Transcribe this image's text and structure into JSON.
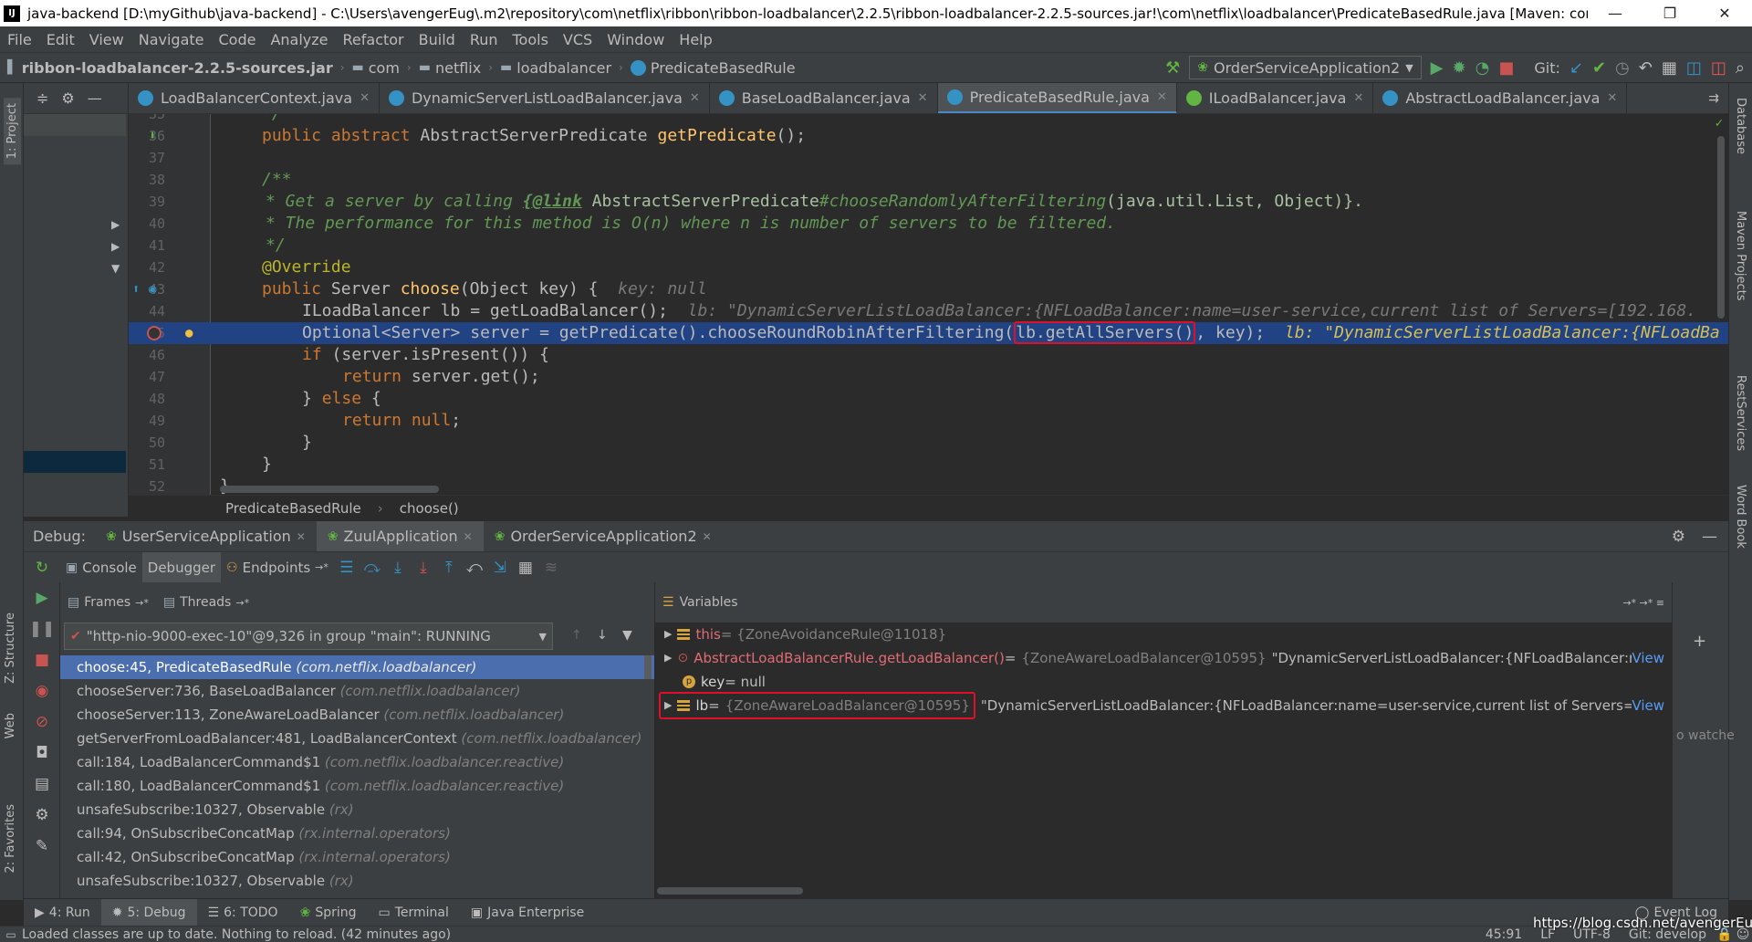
{
  "window": {
    "title": "java-backend [D:\\myGithub\\java-backend] - C:\\Users\\avengerEug\\.m2\\repository\\com\\netflix\\ribbon\\ribbon-loadbalancer\\2.2.5\\ribbon-loadbalancer-2.2.5-sources.jar!\\com\\netflix\\loadbalancer\\PredicateBasedRule.java [Maven: com.ne...",
    "minimize": "—",
    "maximize": "❐",
    "close": "✕"
  },
  "menu": [
    "File",
    "Edit",
    "View",
    "Navigate",
    "Code",
    "Analyze",
    "Refactor",
    "Build",
    "Run",
    "Tools",
    "VCS",
    "Window",
    "Help"
  ],
  "nav": {
    "breadcrumbs": [
      "ribbon-loadbalancer-2.2.5-sources.jar",
      "com",
      "netflix",
      "loadbalancer",
      "PredicateBasedRule"
    ],
    "run_config": "OrderServiceApplication2",
    "git_label": "Git:"
  },
  "left_strip": {
    "project": "1: Project",
    "structure": "Z: Structure",
    "web": "Web",
    "favorites": "2: Favorites"
  },
  "right_strip": [
    "Database",
    "Maven Projects",
    "RestServices",
    "Word Book"
  ],
  "editor_tabs": [
    {
      "label": "LoadBalancerContext.java",
      "active": false
    },
    {
      "label": "DynamicServerListLoadBalancer.java",
      "active": false
    },
    {
      "label": "BaseLoadBalancer.java",
      "active": false
    },
    {
      "label": "PredicateBasedRule.java",
      "active": true
    },
    {
      "label": "ILoadBalancer.java",
      "active": false
    },
    {
      "label": "AbstractLoadBalancer.java",
      "active": false
    }
  ],
  "code": {
    "line_numbers": [
      "35",
      "36",
      "37",
      "38",
      "39",
      "40",
      "41",
      "42",
      "43",
      "44",
      "45",
      "46",
      "47",
      "48",
      "49",
      "50",
      "51",
      "52"
    ],
    "l35": "*/",
    "l36_kw": "public abstract ",
    "l36_type": "AbstractServerPredicate ",
    "l36_fn": "getPredicate",
    "l36_rest": "();",
    "l38": "/**",
    "l39_a": "* Get a server by calling ",
    "l39_tag": "{@link",
    "l39_b": " AbstractServerPredicate",
    "l39_c": "#chooseRandomlyAfterFiltering",
    "l39_d": "(java.util.List, Object)}.",
    "l40": "* The performance for this method is O(n) where n is number of servers to be filtered.",
    "l41": "*/",
    "l42": "@Override",
    "l43_kw": "public ",
    "l43_type": "Server ",
    "l43_fn": "choose",
    "l43_rest": "(Object key) {  ",
    "l43_dbg": "key: null",
    "l44_code": "ILoadBalancer lb = getLoadBalancer();  ",
    "l44_dbg": "lb: \"DynamicServerListLoadBalancer:{NFLoadBalancer:name=user-service,current list of Servers=[192.168.",
    "l45_a": "Optional<Server> server = getPredicate().chooseRoundRobinAfterFiltering(",
    "l45_box": "lb.getAllServers()",
    "l45_b": ", key);  ",
    "l45_dbg": "lb: \"DynamicServerListLoadBalancer:{NFLoadBa",
    "l46_kw": "if ",
    "l46_rest": "(server.isPresent()) {",
    "l47_kw": "return ",
    "l47_rest": "server.get();",
    "l48_a": "} ",
    "l48_kw": "else ",
    "l48_b": "{",
    "l49_kw": "return null",
    "l49_b": ";",
    "l50": "}",
    "l51": "}",
    "l52": "}"
  },
  "editor_breadcrumb": [
    "PredicateBasedRule",
    "choose()"
  ],
  "debug": {
    "label": "Debug:",
    "sessions": [
      "UserServiceApplication",
      "ZuulApplication",
      "OrderServiceApplication2"
    ],
    "subtabs": [
      "Console",
      "Debugger",
      "Endpoints"
    ],
    "frames_label": "Frames",
    "threads_label": "Threads",
    "thread": "\"http-nio-9000-exec-10\"@9,326 in group \"main\": RUNNING",
    "frames": [
      {
        "m": "choose:45, PredicateBasedRule ",
        "p": "(com.netflix.loadbalancer)"
      },
      {
        "m": "chooseServer:736, BaseLoadBalancer ",
        "p": "(com.netflix.loadbalancer)"
      },
      {
        "m": "chooseServer:113, ZoneAwareLoadBalancer ",
        "p": "(com.netflix.loadbalancer)"
      },
      {
        "m": "getServerFromLoadBalancer:481, LoadBalancerContext ",
        "p": "(com.netflix.loadbalancer)"
      },
      {
        "m": "call:184, LoadBalancerCommand$1 ",
        "p": "(com.netflix.loadbalancer.reactive)"
      },
      {
        "m": "call:180, LoadBalancerCommand$1 ",
        "p": "(com.netflix.loadbalancer.reactive)"
      },
      {
        "m": "unsafeSubscribe:10327, Observable ",
        "p": "(rx)"
      },
      {
        "m": "call:94, OnSubscribeConcatMap ",
        "p": "(rx.internal.operators)"
      },
      {
        "m": "call:42, OnSubscribeConcatMap ",
        "p": "(rx.internal.operators)"
      },
      {
        "m": "unsafeSubscribe:10327, Observable ",
        "p": "(rx)"
      }
    ],
    "variables_label": "Variables",
    "vars": {
      "this_name": "this",
      "this_val": " = {ZoneAvoidanceRule@11018}",
      "getlb_name": "AbstractLoadBalancerRule.getLoadBalancer()",
      "getlb_eq": " = ",
      "getlb_val": "{ZoneAwareLoadBalancer@10595}",
      "getlb_str": " \"DynamicServerListLoadBalancer:{NFLoadBalancer:name...",
      "key_name": "key",
      "key_val": " = null",
      "lb_name": "lb",
      "lb_eq": " = ",
      "lb_val": "{ZoneAwareLoadBalancer@10595}",
      "lb_str": " \"DynamicServerListLoadBalancer:{NFLoadBalancer:name=user-service,current list of Servers=[192.1...",
      "view": "View"
    },
    "watches": "o watche"
  },
  "bottom_tools": [
    "4: Run",
    "5: Debug",
    "6: TODO",
    "Spring",
    "Terminal",
    "Java Enterprise"
  ],
  "event_log": "Event Log",
  "status": {
    "message": "Loaded classes are up to date. Nothing to reload. (42 minutes ago)",
    "position": "45:91",
    "line_sep": "LF",
    "encoding": "UTF-8",
    "git": "Git: develop"
  },
  "watermark": "https://blog.csdn.net/avengerEug",
  "colors": {
    "accent": "#4a88c7",
    "highlight": "#214283",
    "annotation_box": "#e0102a",
    "selected_frame": "#4b6eaf"
  }
}
